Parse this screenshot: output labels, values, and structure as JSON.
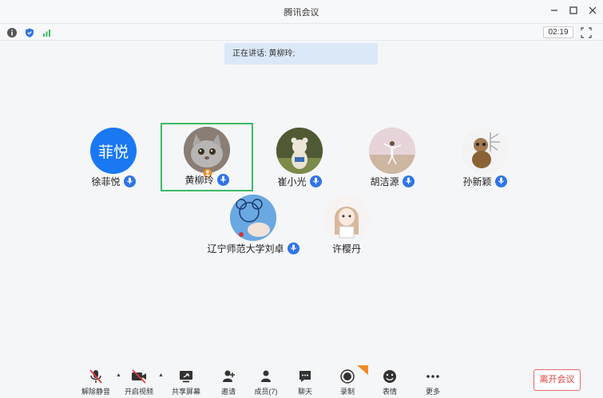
{
  "window": {
    "title": "腾讯会议"
  },
  "status": {
    "timer": "02:19"
  },
  "banner": {
    "speaking_text": "正在讲话: 黄柳玲;"
  },
  "participants": [
    {
      "name": "徐菲悦",
      "avatar_text": "菲悦",
      "avatar_color": "#1a78f2"
    },
    {
      "name": "黄柳玲",
      "active": true
    },
    {
      "name": "崔小光"
    },
    {
      "name": "胡洁源"
    },
    {
      "name": "孙新颖"
    },
    {
      "name": "辽宁师范大学刘卓"
    },
    {
      "name": "许樱丹"
    }
  ],
  "toolbar": {
    "unmute": "解除静音",
    "start_video": "开启视频",
    "share_screen": "共享屏幕",
    "invite": "邀请",
    "members": "成员(7)",
    "chat": "聊天",
    "record": "录制",
    "emoji": "表情",
    "more": "更多",
    "leave": "离开会议"
  },
  "colors": {
    "active_border": "#3cbb64",
    "mic_blue": "#2f74e8",
    "leave_red": "#e03b3b"
  }
}
